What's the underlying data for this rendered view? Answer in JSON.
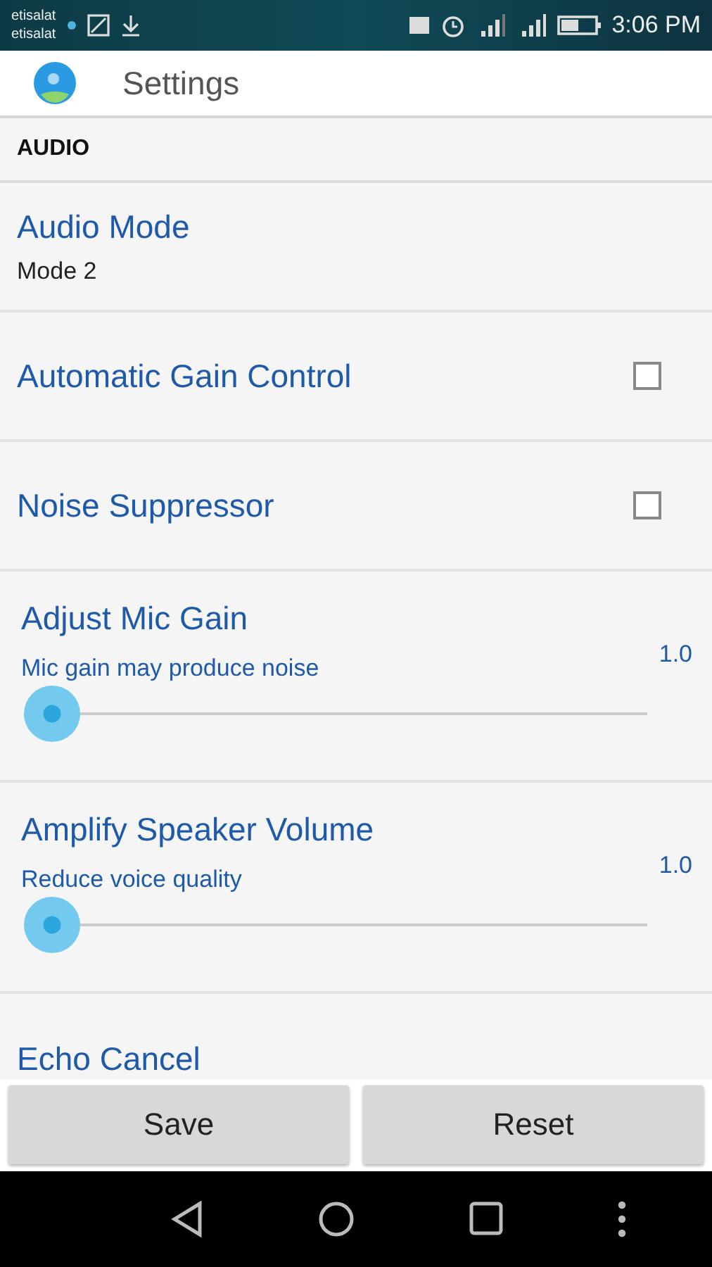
{
  "status_bar": {
    "carriers": [
      "etisalat",
      "etisalat"
    ],
    "time": "3:06 PM"
  },
  "app_bar": {
    "title": "Settings"
  },
  "section": {
    "title": "AUDIO"
  },
  "preferences": [
    {
      "kind": "text",
      "title": "Audio Mode",
      "summary": "Mode 2"
    },
    {
      "kind": "checkbox",
      "title": "Automatic Gain Control",
      "checked": false
    },
    {
      "kind": "checkbox",
      "title": "Noise Suppressor",
      "checked": false
    },
    {
      "kind": "slider",
      "title": "Adjust Mic Gain",
      "summary": "Mic gain may produce noise",
      "reading": "1.0",
      "level": 0
    },
    {
      "kind": "slider",
      "title": "Amplify Speaker Volume",
      "summary": "Reduce voice quality",
      "reading": "1.0",
      "level": 0
    },
    {
      "kind": "text",
      "title": "Echo Cancel"
    }
  ],
  "buttons": [
    "Save",
    "Reset"
  ]
}
